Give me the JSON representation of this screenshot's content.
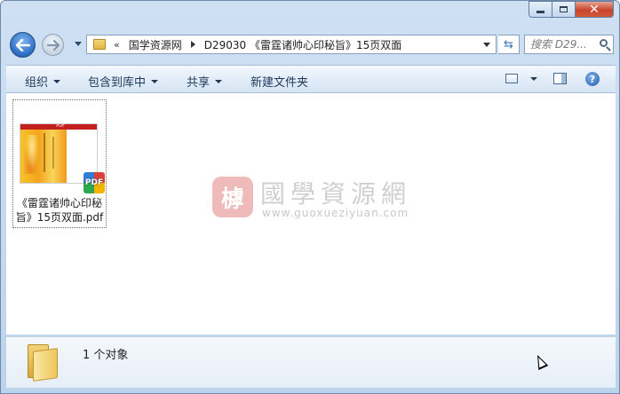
{
  "window": {
    "controls": {
      "minimize_icon": "minimize-icon",
      "maximize_icon": "maximize-icon",
      "close_icon": "close-icon",
      "close_glyph": "✕"
    }
  },
  "nav": {
    "back_icon": "back-arrow-icon",
    "forward_icon": "forward-arrow-icon",
    "address": {
      "overflow_glyph": "«",
      "crumbs": [
        "国学资源网",
        "D29030 《雷霆诸帅心印秘旨》15页双面"
      ]
    },
    "refresh_glyph": "⇆",
    "search": {
      "placeholder": "搜索 D29..."
    }
  },
  "toolbar": {
    "organize": "组织",
    "include_in_library": "包含到库中",
    "share": "共享",
    "new_folder": "新建文件夹",
    "help_glyph": "?"
  },
  "content": {
    "files": [
      {
        "name": "《雷霆诸帅心印秘旨》15页双面.pdf",
        "badge": "PDF",
        "thumb_header": "PDF"
      }
    ],
    "watermark": {
      "logo_glyph": "㯉",
      "title": "國學資源網",
      "url": "www.guoxueziyuan.com"
    }
  },
  "details": {
    "count_text": "1 个对象"
  },
  "colors": {
    "close_red": "#c7452b",
    "accent_blue": "#2b6cc4",
    "toolbar_text": "#1e3a5a",
    "thumb_red": "#c41f1f"
  }
}
